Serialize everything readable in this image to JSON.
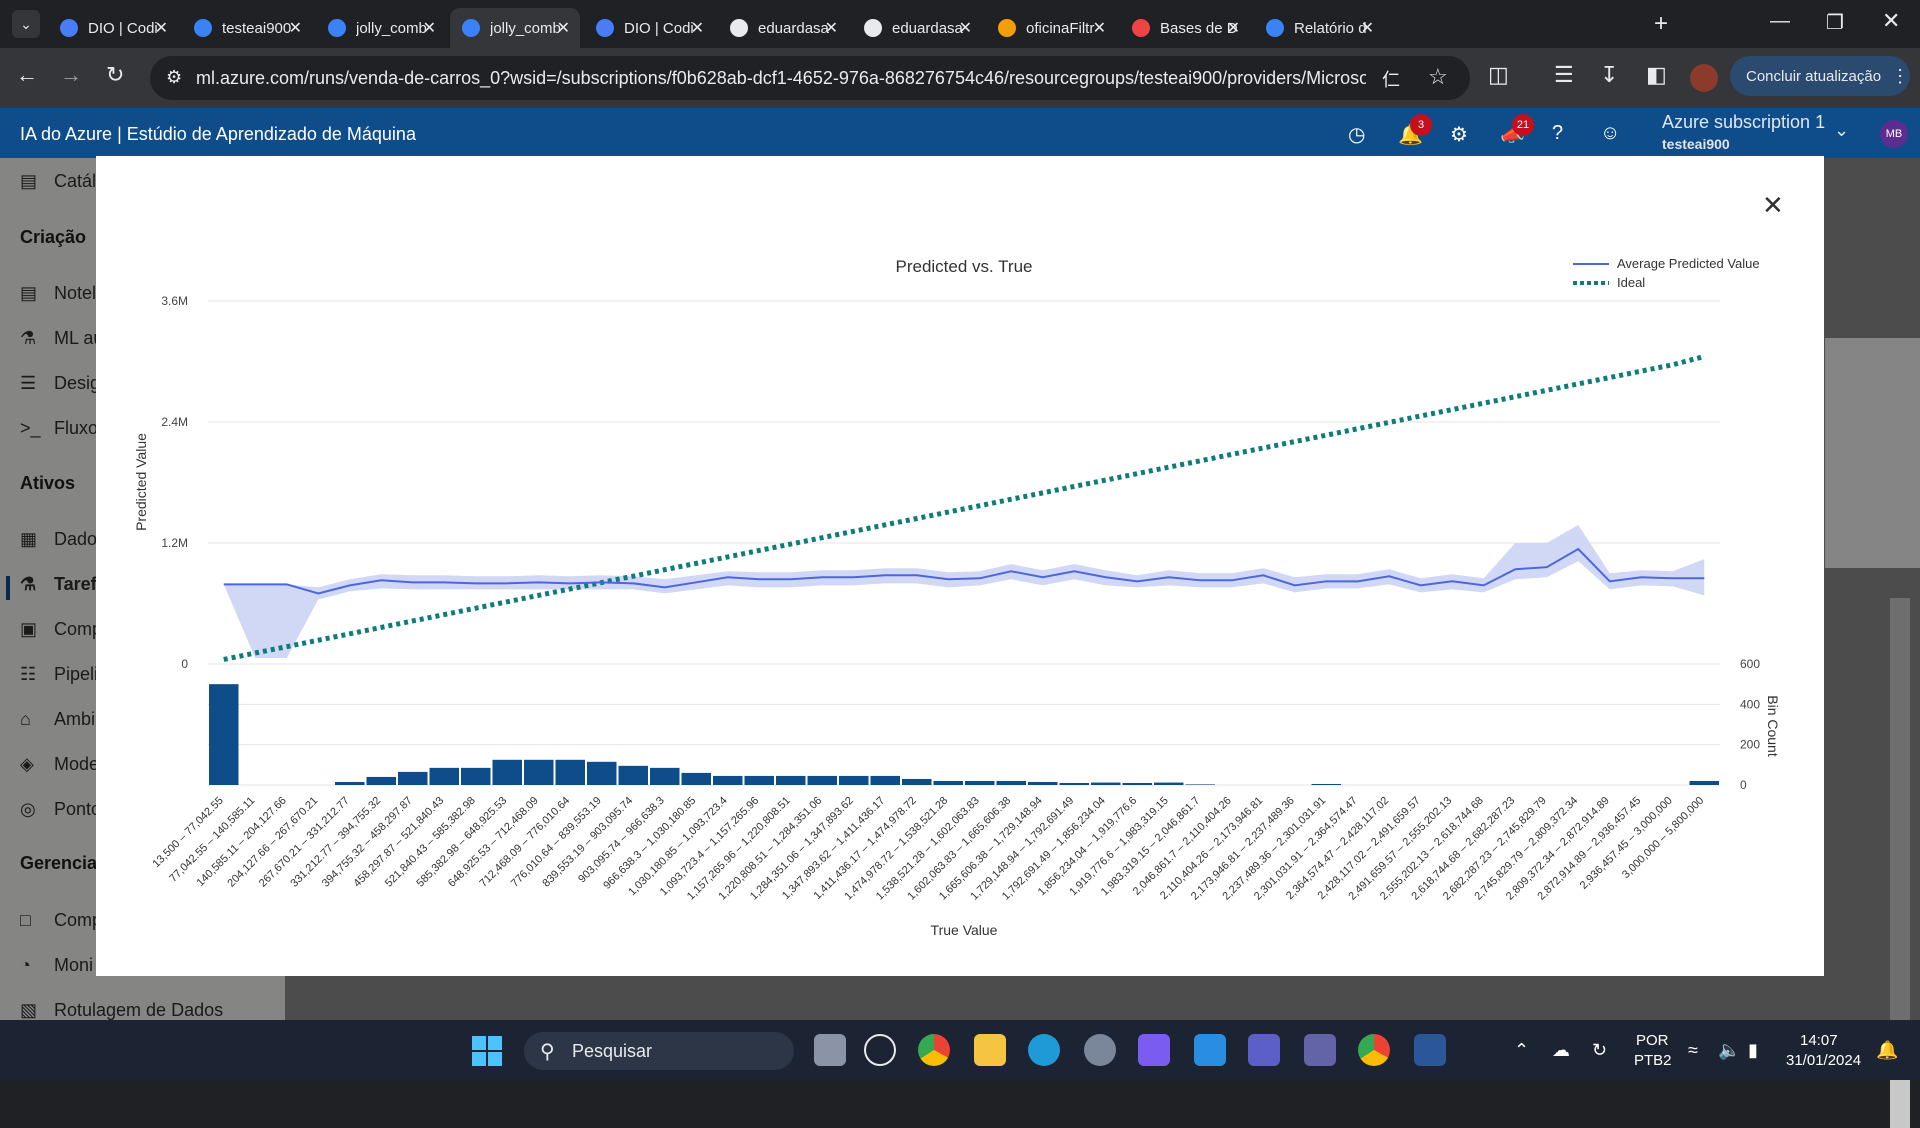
{
  "browser": {
    "tabs": [
      {
        "label": "DIO | Codi",
        "color": "#4a7cf7",
        "active": false
      },
      {
        "label": "testeai900",
        "color": "#3b82f6",
        "active": false
      },
      {
        "label": "jolly_comb",
        "color": "#3b82f6",
        "active": false
      },
      {
        "label": "jolly_comb",
        "color": "#3b82f6",
        "active": true
      },
      {
        "label": "DIO | Codi",
        "color": "#4a7cf7",
        "active": false
      },
      {
        "label": "eduardasa",
        "color": "#e8eaed",
        "active": false
      },
      {
        "label": "eduardasa",
        "color": "#e8eaed",
        "active": false
      },
      {
        "label": "oficinaFiltr",
        "color": "#f59e0b",
        "active": false
      },
      {
        "label": "Bases de D",
        "color": "#ef4444",
        "active": false
      },
      {
        "label": "Relatório d",
        "color": "#3b82f6",
        "active": false
      }
    ],
    "url": "ml.azure.com/runs/venda-de-carros_0?wsid=/subscriptions/f0b628ab-dcf1-4652-976a-868276754c46/resourcegroups/testeai900/providers/Microsoft....",
    "update_label": "Concluir atualização"
  },
  "azure": {
    "title": "IA do Azure | Estúdio de Aprendizado de Máquina",
    "notif_count": "3",
    "feedback_count": "21",
    "subscription": "Azure subscription 1",
    "workspace": "testeai900",
    "avatar": "MB"
  },
  "sidebar": {
    "catalog": "Catál",
    "section_create": "Criação",
    "create_items": [
      "Notel",
      "ML au",
      "Desig",
      "Fluxo"
    ],
    "section_assets": "Ativos",
    "asset_items": [
      "Dado",
      "Tarefa",
      "Comp",
      "Pipeli",
      "Ambi",
      "Mode",
      "Ponto"
    ],
    "section_manage": "Gerenciar",
    "manage_items": [
      "Comp",
      "Moni",
      "Rotulagem de Dados"
    ]
  },
  "chart_data": {
    "type": "line",
    "title": "Predicted vs. True",
    "xlabel": "True Value",
    "ylabel": "Predicted Value",
    "y2label": "Bin Count",
    "ylim": [
      0,
      3600000
    ],
    "y2lim": [
      0,
      600
    ],
    "yticks": [
      "0",
      "1.2M",
      "2.4M",
      "3.6M"
    ],
    "y2ticks": [
      "0",
      "200",
      "400",
      "600"
    ],
    "legend": [
      "Average Predicted Value",
      "Ideal"
    ],
    "legend_position": "top-right",
    "colors": {
      "average": "#4c66e0",
      "band": "#c9d1f5",
      "ideal": "#0f7b7b",
      "bars": "#0f4c8a"
    },
    "categories": [
      "13,500 – 77,042.55",
      "77,042.55 – 140,585.11",
      "140,585.11 – 204,127.66",
      "204,127.66 – 267,670.21",
      "267,670.21 – 331,212.77",
      "331,212.77 – 394,755.32",
      "394,755.32 – 458,297.87",
      "458,297.87 – 521,840.43",
      "521,840.43 – 585,382.98",
      "585,382.98 – 648,925.53",
      "648,925.53 – 712,468.09",
      "712,468.09 – 776,010.64",
      "776,010.64 – 839,553.19",
      "839,553.19 – 903,095.74",
      "903,095.74 – 966,638.3",
      "966,638.3 – 1,030,180.85",
      "1,030,180.85 – 1,093,723.4",
      "1,093,723.4 – 1,157,265.96",
      "1,157,265.96 – 1,220,808.51",
      "1,220,808.51 – 1,284,351.06",
      "1,284,351.06 – 1,347,893.62",
      "1,347,893.62 – 1,411,436.17",
      "1,411,436.17 – 1,474,978.72",
      "1,474,978.72 – 1,538,521.28",
      "1,538,521.28 – 1,602,063.83",
      "1,602,063.83 – 1,665,606.38",
      "1,665,606.38 – 1,729,148.94",
      "1,729,148.94 – 1,792,691.49",
      "1,792,691.49 – 1,856,234.04",
      "1,856,234.04 – 1,919,776.6",
      "1,919,776.6 – 1,983,319.15",
      "1,983,319.15 – 2,046,861.7",
      "2,046,861.7 – 2,110,404.26",
      "2,110,404.26 – 2,173,946.81",
      "2,173,946.81 – 2,237,489.36",
      "2,237,489.36 – 2,301,031.91",
      "2,301,031.91 – 2,364,574.47",
      "2,364,574.47 – 2,428,117.02",
      "2,428,117.02 – 2,491,659.57",
      "2,491,659.57 – 2,555,202.13",
      "2,555,202.13 – 2,618,744.68",
      "2,618,744.68 – 2,682,287.23",
      "2,682,287.23 – 2,745,829.79",
      "2,745,829.79 – 2,809,372.34",
      "2,809,372.34 – 2,872,914.89",
      "2,872,914.89 – 2,936,457.45",
      "2,936,457.45 – 3,000,000",
      "3,000,000 – 5,800,000"
    ],
    "average": [
      790000,
      790000,
      790000,
      700000,
      780000,
      830000,
      810000,
      810000,
      800000,
      800000,
      810000,
      800000,
      810000,
      800000,
      760000,
      810000,
      860000,
      840000,
      840000,
      860000,
      860000,
      880000,
      880000,
      840000,
      850000,
      920000,
      860000,
      920000,
      860000,
      820000,
      860000,
      830000,
      830000,
      880000,
      780000,
      820000,
      820000,
      870000,
      780000,
      820000,
      780000,
      940000,
      960000,
      1140000,
      820000,
      860000,
      850000,
      850000
    ],
    "band_low": [
      790000,
      60000,
      60000,
      640000,
      720000,
      750000,
      740000,
      740000,
      740000,
      740000,
      740000,
      740000,
      740000,
      740000,
      700000,
      740000,
      780000,
      760000,
      760000,
      780000,
      780000,
      800000,
      800000,
      760000,
      780000,
      840000,
      780000,
      840000,
      780000,
      760000,
      780000,
      760000,
      760000,
      800000,
      710000,
      750000,
      750000,
      790000,
      710000,
      740000,
      710000,
      840000,
      860000,
      1020000,
      740000,
      780000,
      770000,
      680000
    ],
    "band_high": [
      790000,
      790000,
      790000,
      760000,
      840000,
      890000,
      880000,
      880000,
      870000,
      870000,
      880000,
      870000,
      880000,
      870000,
      840000,
      880000,
      920000,
      910000,
      910000,
      930000,
      930000,
      950000,
      950000,
      910000,
      920000,
      990000,
      930000,
      990000,
      930000,
      880000,
      930000,
      900000,
      900000,
      950000,
      860000,
      890000,
      890000,
      940000,
      850000,
      890000,
      850000,
      1200000,
      1200000,
      1380000,
      900000,
      930000,
      920000,
      1040000
    ],
    "ideal": [
      45000,
      109000,
      172000,
      236000,
      299000,
      363000,
      427000,
      490000,
      554000,
      617000,
      681000,
      744000,
      808000,
      871000,
      935000,
      998000,
      1062000,
      1126000,
      1189000,
      1253000,
      1316000,
      1380000,
      1443000,
      1507000,
      1570000,
      1634000,
      1697000,
      1761000,
      1824000,
      1888000,
      1952000,
      2015000,
      2079000,
      2142000,
      2206000,
      2269000,
      2333000,
      2396000,
      2460000,
      2523000,
      2587000,
      2651000,
      2714000,
      2778000,
      2841000,
      2905000,
      2968000,
      3050000
    ],
    "bin_count": [
      500,
      0,
      0,
      0,
      15,
      40,
      65,
      85,
      85,
      125,
      125,
      125,
      115,
      95,
      85,
      60,
      45,
      45,
      45,
      45,
      45,
      45,
      30,
      20,
      20,
      20,
      15,
      10,
      12,
      10,
      12,
      3,
      0,
      0,
      0,
      5,
      0,
      0,
      0,
      0,
      0,
      0,
      0,
      0,
      0,
      0,
      0,
      20
    ]
  },
  "taskbar": {
    "search_placeholder": "Pesquisar",
    "lang": "POR",
    "layout": "PTB2",
    "time": "14:07",
    "date": "31/01/2024"
  }
}
